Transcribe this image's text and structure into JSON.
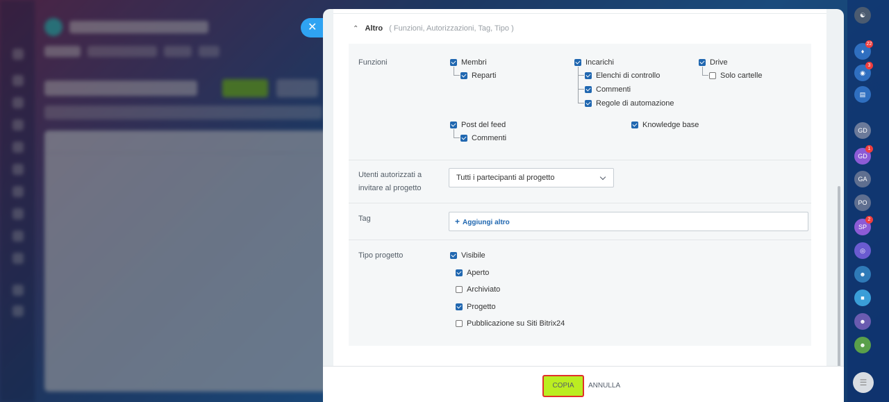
{
  "section": {
    "title": "Altro",
    "hint": "( Funzioni, Autorizzazioni, Tag, Tipo )"
  },
  "functions": {
    "label": "Funzioni",
    "members": {
      "label": "Membri",
      "checked": true
    },
    "departments": {
      "label": "Reparti",
      "checked": true
    },
    "tasks": {
      "label": "Incarichi",
      "checked": true
    },
    "checklists": {
      "label": "Elenchi di controllo",
      "checked": true
    },
    "task_comments": {
      "label": "Commenti",
      "checked": true
    },
    "automation": {
      "label": "Regole di automazione",
      "checked": true
    },
    "drive": {
      "label": "Drive",
      "checked": true
    },
    "folders_only": {
      "label": "Solo cartelle",
      "checked": false
    },
    "feed_posts": {
      "label": "Post del feed",
      "checked": true
    },
    "feed_comments": {
      "label": "Commenti",
      "checked": true
    },
    "knowledge": {
      "label": "Knowledge base",
      "checked": true
    }
  },
  "invite": {
    "label_line1": "Utenti autorizzati a",
    "label_line2": "invitare al progetto",
    "selected": "Tutti i partecipanti al progetto"
  },
  "tags": {
    "label": "Tag",
    "add_label": "Aggiungi altro"
  },
  "project_type": {
    "label": "Tipo progetto",
    "visible": {
      "label": "Visibile",
      "checked": true
    },
    "open": {
      "label": "Aperto",
      "checked": true
    },
    "archived": {
      "label": "Archiviato",
      "checked": false
    },
    "project": {
      "label": "Progetto",
      "checked": true
    },
    "publish": {
      "label": "Pubblicazione su Siti Bitrix24",
      "checked": false
    }
  },
  "footer": {
    "copy_label": "COPIA",
    "cancel_label": "ANNULLA"
  },
  "rightbar": {
    "notifications_count": "22",
    "activity_count": "3",
    "avatars": [
      "GD",
      "GD",
      "GA",
      "PO",
      "SP"
    ],
    "badge_gd": "1",
    "badge_sp": "2"
  },
  "colors": {
    "accent": "#2067b0",
    "copy_button": "#bbed21",
    "highlight": "#e0302b",
    "close_button": "#2fa3f2"
  }
}
